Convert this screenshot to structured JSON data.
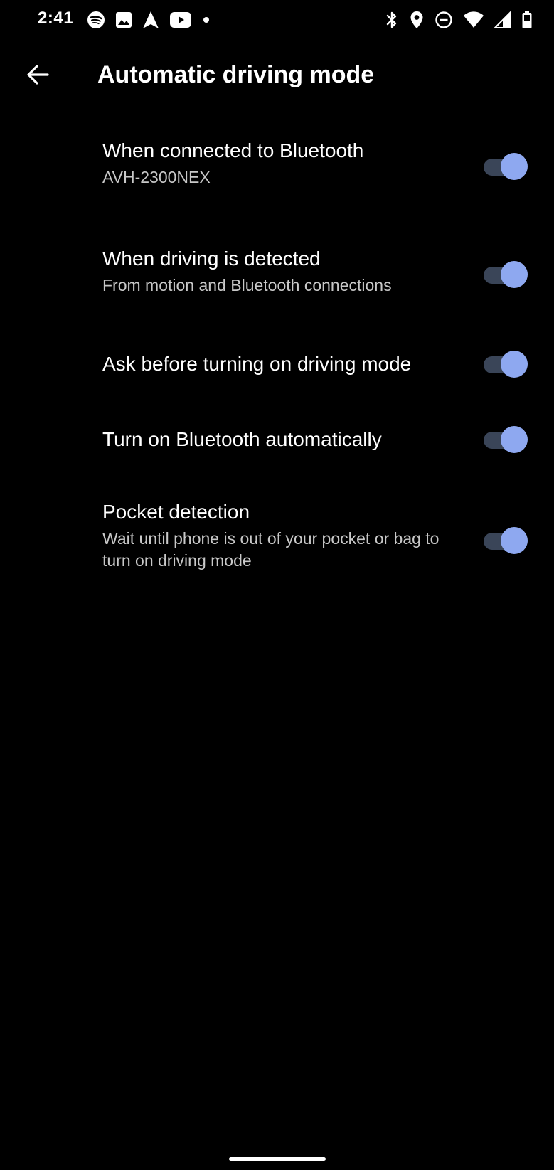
{
  "status_bar": {
    "time": "2:41",
    "left_icons": [
      "spotify-icon",
      "image-icon",
      "navigation-icon",
      "youtube-icon",
      "dot-icon"
    ],
    "right_icons": [
      "bluetooth-icon",
      "location-icon",
      "do-not-disturb-icon",
      "wifi-icon",
      "cell-signal-icon",
      "battery-icon"
    ]
  },
  "app_bar": {
    "back_icon": "arrow-back-icon",
    "title": "Automatic driving mode"
  },
  "settings": [
    {
      "title": "When connected to Bluetooth",
      "summary": "AVH-2300NEX",
      "enabled": true
    },
    {
      "title": "When driving is detected",
      "summary": "From motion and Bluetooth connections",
      "enabled": true
    },
    {
      "title": "Ask before turning on driving mode",
      "summary": "",
      "enabled": true
    },
    {
      "title": "Turn on Bluetooth automatically",
      "summary": "",
      "enabled": true
    },
    {
      "title": "Pocket detection",
      "summary": "Wait until phone is out of your pocket or bag to turn on driving mode",
      "enabled": true
    }
  ],
  "colors": {
    "background": "#000000",
    "switch_thumb_on": "#8ea8f0",
    "switch_track_on": "#3a4558",
    "summary_text": "#c8c8c8"
  }
}
